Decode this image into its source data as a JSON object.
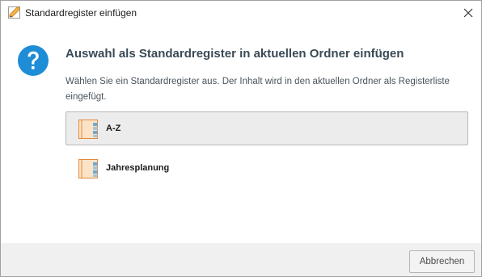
{
  "window": {
    "title": "Standardregister einfügen",
    "close_icon": "close-icon"
  },
  "content": {
    "icon": "question-icon",
    "heading": "Auswahl als Standardregister in aktuellen Ordner einfügen",
    "description": "Wählen Sie ein Standardregister aus. Der Inhalt wird in den aktuellen Ordner als Registerliste eingefügt."
  },
  "options": [
    {
      "label": "A-Z",
      "icon": "register-icon",
      "selected": true
    },
    {
      "label": "Jahresplanung",
      "icon": "register-icon",
      "selected": false
    }
  ],
  "footer": {
    "cancel_label": "Abbrechen"
  },
  "colors": {
    "accent": "#1f8dd6",
    "heading": "#3a4a55",
    "selection_bg": "#ececec"
  }
}
